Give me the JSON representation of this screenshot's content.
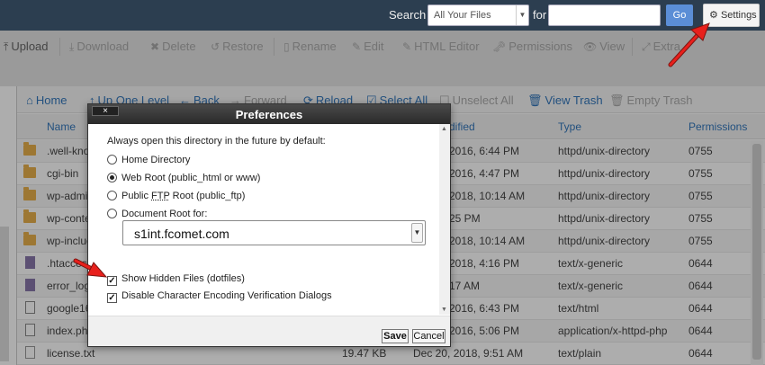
{
  "topbar": {
    "search_label": "Search",
    "search_scope": "All Your Files",
    "for_label": "for",
    "search_value": "",
    "go_label": "Go",
    "settings_label": "Settings"
  },
  "toolbar": {
    "upload": "Upload",
    "download": "Download",
    "delete": "Delete",
    "restore": "Restore",
    "rename": "Rename",
    "edit": "Edit",
    "html_editor": "HTML Editor",
    "permissions": "Permissions",
    "view": "View",
    "extract": "Extra"
  },
  "nav": {
    "home": "Home",
    "up_one_level": "Up One Level",
    "back": "Back",
    "forward": "Forward",
    "reload": "Reload",
    "select_all": "Select All",
    "unselect_all": "Unselect All",
    "view_trash": "View Trash",
    "empty_trash": "Empty Trash"
  },
  "columns": {
    "name": "Name",
    "modified": "dified",
    "type": "Type",
    "permissions": "Permissions"
  },
  "files": [
    {
      "name": ".well-know",
      "size": "",
      "modified": "2016, 6:44 PM",
      "type": "httpd/unix-directory",
      "perms": "0755",
      "icon": "folder-icon"
    },
    {
      "name": "cgi-bin",
      "size": "",
      "modified": "2016, 4:47 PM",
      "type": "httpd/unix-directory",
      "perms": "0755",
      "icon": "folder-icon"
    },
    {
      "name": "wp-admin",
      "size": "",
      "modified": "2018, 10:14 AM",
      "type": "httpd/unix-directory",
      "perms": "0755",
      "icon": "folder-icon"
    },
    {
      "name": "wp-conte",
      "size": "",
      "modified": "25 PM",
      "type": "httpd/unix-directory",
      "perms": "0755",
      "icon": "folder-icon"
    },
    {
      "name": "wp-incluc",
      "size": "",
      "modified": "2018, 10:14 AM",
      "type": "httpd/unix-directory",
      "perms": "0755",
      "icon": "folder-icon"
    },
    {
      "name": ".htacces",
      "size": "",
      "modified": "2018, 4:16 PM",
      "type": "text/x-generic",
      "perms": "0644",
      "icon": "file-icon"
    },
    {
      "name": "error_log",
      "size": "",
      "modified": "17 AM",
      "type": "text/x-generic",
      "perms": "0644",
      "icon": "file-icon"
    },
    {
      "name": "google16",
      "size": "",
      "modified": "2016, 6:43 PM",
      "type": "text/html",
      "perms": "0644",
      "icon": "code-icon"
    },
    {
      "name": "index.php",
      "size": "",
      "modified": "2016, 5:06 PM",
      "type": "application/x-httpd-php",
      "perms": "0644",
      "icon": "code-icon"
    },
    {
      "name": "license.txt",
      "size": "19.47 KB",
      "modified": "Dec 20, 2018, 9:51 AM",
      "type": "text/plain",
      "perms": "0644",
      "icon": "doc-icon"
    }
  ],
  "dialog": {
    "title": "Preferences",
    "close_label": "×",
    "intro": "Always open this directory in the future by default:",
    "options": {
      "home": "Home Directory",
      "webroot": "Web Root (public_html or www)",
      "ftp_prefix": "Public ",
      "ftp_abbr": "FTP",
      "ftp_suffix": " Root (public_ftp)",
      "docroot": "Document Root for:"
    },
    "docroot_value": "s1int.fcomet.com",
    "show_hidden": "Show Hidden Files (dotfiles)",
    "disable_encoding": "Disable Character Encoding Verification Dialogs",
    "save_label": "Save",
    "cancel_label": "Cancel"
  },
  "colors": {
    "topbar": "#2c3e50",
    "link": "#3377bb",
    "go": "#5b8ed6",
    "arrow": "#e8201c"
  }
}
